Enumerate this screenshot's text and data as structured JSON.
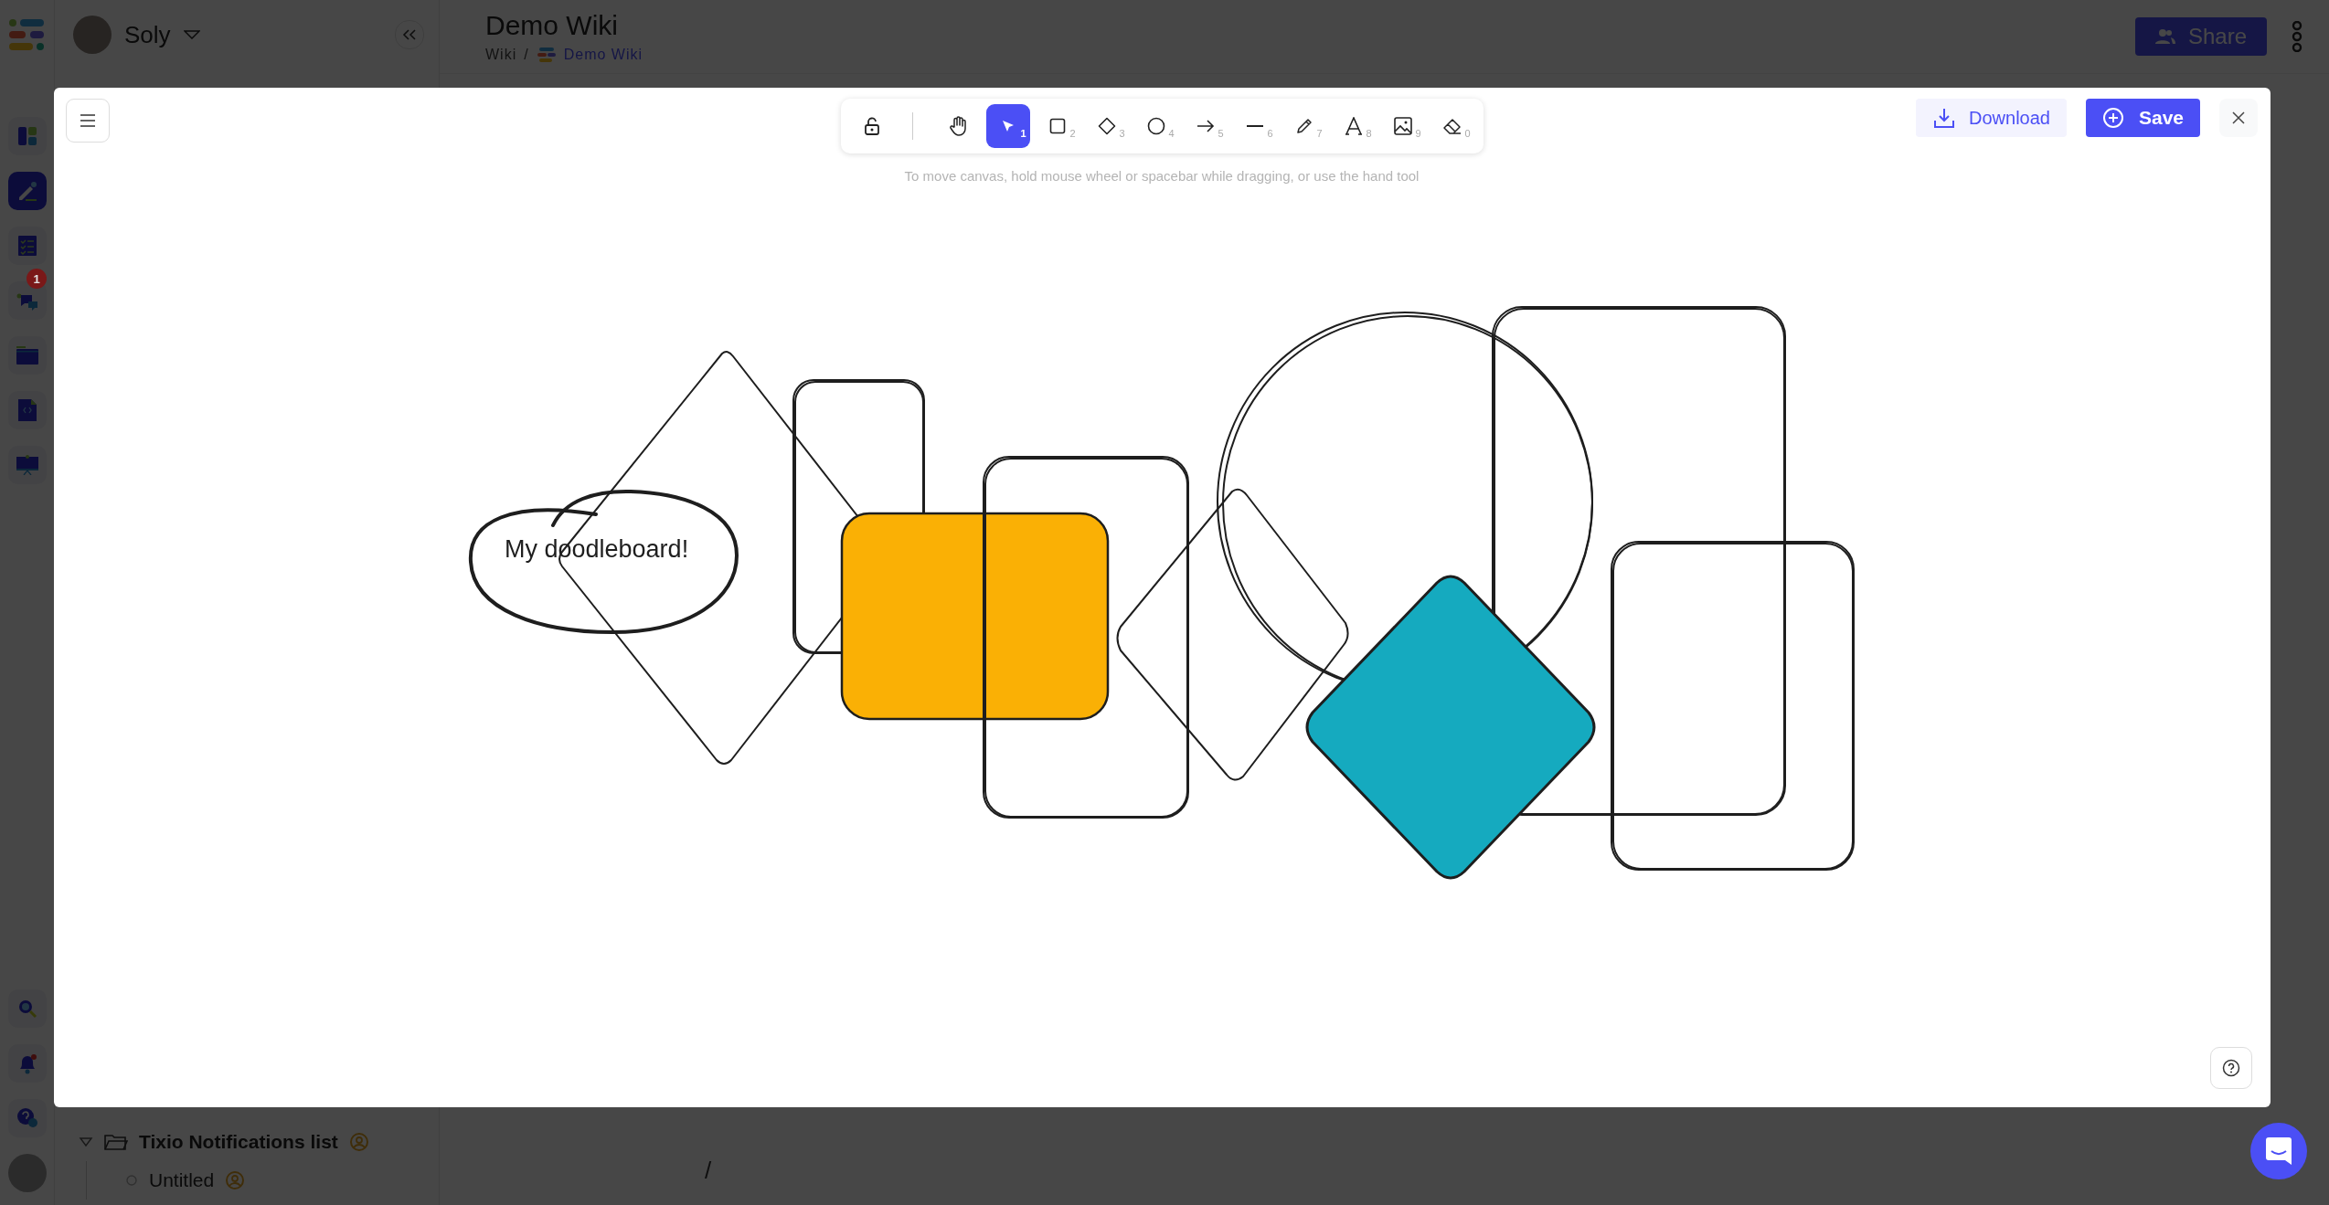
{
  "app": {
    "rail_items": [
      {
        "kind": "board",
        "selected": false
      },
      {
        "kind": "pen",
        "selected": true
      },
      {
        "kind": "tasks",
        "selected": false
      },
      {
        "kind": "chat",
        "selected": false,
        "badge": "1"
      },
      {
        "kind": "folder",
        "selected": false
      },
      {
        "kind": "code-file",
        "selected": false
      },
      {
        "kind": "presentation",
        "selected": false
      }
    ],
    "rail_bottom": [
      {
        "kind": "search"
      },
      {
        "kind": "bell"
      },
      {
        "kind": "help"
      }
    ],
    "user": "Soly",
    "sidebar_items": [
      {
        "label": "Tixio Notifications list",
        "kind": "folder",
        "expanded": true
      },
      {
        "label": "Untitled",
        "kind": "page"
      }
    ],
    "page_title": "Demo Wiki",
    "breadcrumb": {
      "root": "Wiki",
      "separator": "/",
      "current": "Demo Wiki"
    },
    "share": "Share",
    "editor_text": "/"
  },
  "whiteboard": {
    "tools": [
      {
        "kind": "lock",
        "selected": false
      },
      {
        "kind": "hand",
        "selected": false
      },
      {
        "kind": "select",
        "shortcut": "1",
        "selected": true
      },
      {
        "kind": "rectangle",
        "shortcut": "2",
        "selected": false
      },
      {
        "kind": "diamond",
        "shortcut": "3",
        "selected": false
      },
      {
        "kind": "ellipse",
        "shortcut": "4",
        "selected": false
      },
      {
        "kind": "arrow",
        "shortcut": "5",
        "selected": false
      },
      {
        "kind": "line",
        "shortcut": "6",
        "selected": false
      },
      {
        "kind": "pencil",
        "shortcut": "7",
        "selected": false
      },
      {
        "kind": "text",
        "shortcut": "8",
        "selected": false
      },
      {
        "kind": "image",
        "shortcut": "9",
        "selected": false
      },
      {
        "kind": "eraser",
        "shortcut": "0",
        "selected": false
      }
    ],
    "hint": "To move canvas, hold mouse wheel or spacebar while dragging, or use the hand tool",
    "download": "Download",
    "save": "Save",
    "canvas_text": "My doodleboard!"
  }
}
